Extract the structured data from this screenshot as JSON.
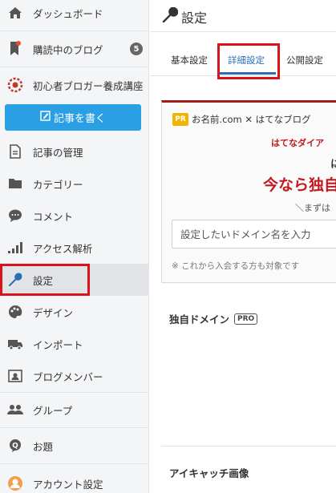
{
  "sidebar": {
    "items": [
      {
        "id": "dashboard",
        "label": "ダッシュボード",
        "icon": "home-icon"
      },
      {
        "id": "reading",
        "label": "購読中のブログ",
        "icon": "bookmark-icon",
        "badge": "5"
      },
      {
        "id": "blog",
        "label": "初心者ブロガー養成講座",
        "icon": "blog-logo-icon"
      },
      {
        "id": "articles",
        "label": "記事の管理",
        "icon": "document-icon"
      },
      {
        "id": "categories",
        "label": "カテゴリー",
        "icon": "folder-icon"
      },
      {
        "id": "comments",
        "label": "コメント",
        "icon": "comment-icon"
      },
      {
        "id": "analytics",
        "label": "アクセス解析",
        "icon": "signal-bars-icon"
      },
      {
        "id": "settings",
        "label": "設定",
        "icon": "wrench-icon"
      },
      {
        "id": "design",
        "label": "デザイン",
        "icon": "palette-icon"
      },
      {
        "id": "import",
        "label": "インポート",
        "icon": "truck-icon"
      },
      {
        "id": "members",
        "label": "ブログメンバー",
        "icon": "id-card-icon"
      },
      {
        "id": "groups",
        "label": "グループ",
        "icon": "people-icon"
      },
      {
        "id": "odai",
        "label": "お題",
        "icon": "q-bubble-icon"
      },
      {
        "id": "account",
        "label": "アカウント設定",
        "icon": "account-icon"
      }
    ],
    "write_button": "記事を書く"
  },
  "main": {
    "title": "設定",
    "tabs": [
      "基本設定",
      "詳細設定",
      "公開設定"
    ],
    "active_tab": "詳細設定",
    "promo": {
      "pr_label": "PR",
      "brand": "お名前.com ✕ はてなブログ",
      "line1": "はてなダイア",
      "line2": "に",
      "line3": "今なら独自",
      "line4": "＼まずは",
      "input_placeholder": "設定したいドメイン名を入力",
      "note": "※ これから入会する方も対象です"
    },
    "sections": {
      "custom_domain": "独自ドメイン",
      "pro_badge": "PRO",
      "eyecatch": "アイキャッチ画像"
    }
  },
  "colors": {
    "accent_blue": "#2a9fe3",
    "active_tab": "#2a6eb6",
    "highlight_red": "#d9121b",
    "promo_red": "#c0191f"
  }
}
